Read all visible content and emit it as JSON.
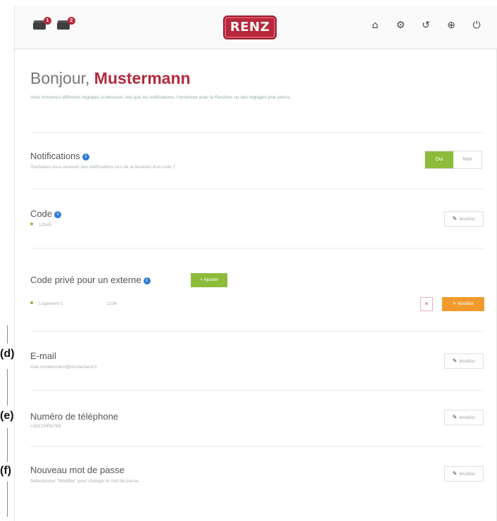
{
  "header": {
    "box_badges": [
      "1",
      "2"
    ],
    "logo_text": "RENZ",
    "icons": [
      "home-icon",
      "gear-icon",
      "history-icon",
      "globe-icon",
      "power-icon"
    ]
  },
  "greeting": {
    "prefix": "Bonjour, ",
    "name": "Mustermann",
    "description": "Vous trouverez différents réglages ci-dessous, tels que les notifications, l'ouverture avec la Renzbox ou des réglages plus précis."
  },
  "notifications": {
    "title": "Notifications",
    "subtitle": "Souhaitez-vous recevoir des notifications lors de la livraison d'un colis ?",
    "on_label": "Oui",
    "off_label": "Non"
  },
  "code": {
    "title": "Code",
    "value": "12345",
    "modify_label": "Modifier"
  },
  "external_code": {
    "title": "Code privé pour un externe",
    "add_label": "Ajouter",
    "entry_name": "Logement 1",
    "entry_code": "1234",
    "delete_label": "×",
    "modify_label": "Modifier"
  },
  "email": {
    "title": "E-mail",
    "value": "max.mustermann@musterland.fr",
    "modify_label": "Modifier"
  },
  "phone": {
    "title": "Numéro de téléphone",
    "value": "+33123456789",
    "modify_label": "Modifier"
  },
  "password": {
    "title": "Nouveau mot de passe",
    "subtitle": "Sélectionner \"Modifier\" pour changer le mot de passe.",
    "modify_label": "Modifier"
  },
  "annotations": {
    "d": "(d)",
    "e": "(e)",
    "f": "(f)"
  },
  "colors": {
    "brand": "#b9283a",
    "accent_green": "#8cbc3a",
    "accent_orange": "#f29a2e",
    "info_blue": "#2e7bd6"
  }
}
